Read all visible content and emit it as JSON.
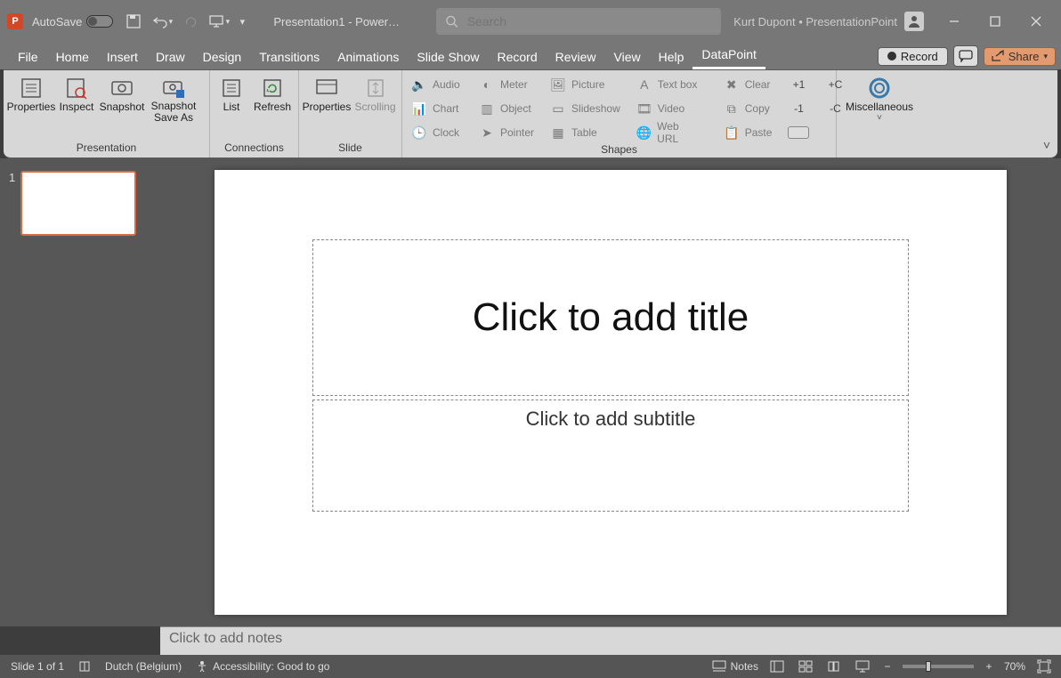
{
  "titlebar": {
    "autosave_label": "AutoSave",
    "doc_title": "Presentation1 - Power…",
    "search_placeholder": "Search",
    "user_label": "Kurt Dupont • PresentationPoint"
  },
  "tabs": {
    "file": "File",
    "home": "Home",
    "insert": "Insert",
    "draw": "Draw",
    "design": "Design",
    "transitions": "Transitions",
    "animations": "Animations",
    "slideshow": "Slide Show",
    "record": "Record",
    "review": "Review",
    "view": "View",
    "help": "Help",
    "datapoint": "DataPoint"
  },
  "record_button": "Record",
  "share_button": "Share",
  "ribbon": {
    "groups": {
      "presentation": "Presentation",
      "connections": "Connections",
      "slide": "Slide",
      "shapes": "Shapes"
    },
    "btns": {
      "properties": "Properties",
      "inspect": "Inspect",
      "snapshot": "Snapshot",
      "snapshot_saveas": "Snapshot\nSave As",
      "list": "List",
      "refresh": "Refresh",
      "slide_properties": "Properties",
      "scrolling": "Scrolling",
      "misc": "Miscellaneous"
    },
    "shapes": {
      "audio": "Audio",
      "meter": "Meter",
      "picture": "Picture",
      "textbox": "Text box",
      "chart": "Chart",
      "object": "Object",
      "slideshow": "Slideshow",
      "video": "Video",
      "clock": "Clock",
      "pointer": "Pointer",
      "table": "Table",
      "weburl": "Web URL",
      "clear": "Clear",
      "copy": "Copy",
      "paste": "Paste"
    },
    "counters": {
      "plus1": "+1",
      "minus1": "-1",
      "plusC": "+C",
      "minusC": "-C"
    }
  },
  "slide": {
    "number": "1",
    "title_placeholder": "Click to add title",
    "subtitle_placeholder": "Click to add subtitle"
  },
  "notes": {
    "placeholder": "Click to add notes"
  },
  "status": {
    "slide_count": "Slide 1 of 1",
    "language": "Dutch (Belgium)",
    "accessibility": "Accessibility: Good to go",
    "notes_btn": "Notes",
    "zoom_pct": "70%"
  }
}
